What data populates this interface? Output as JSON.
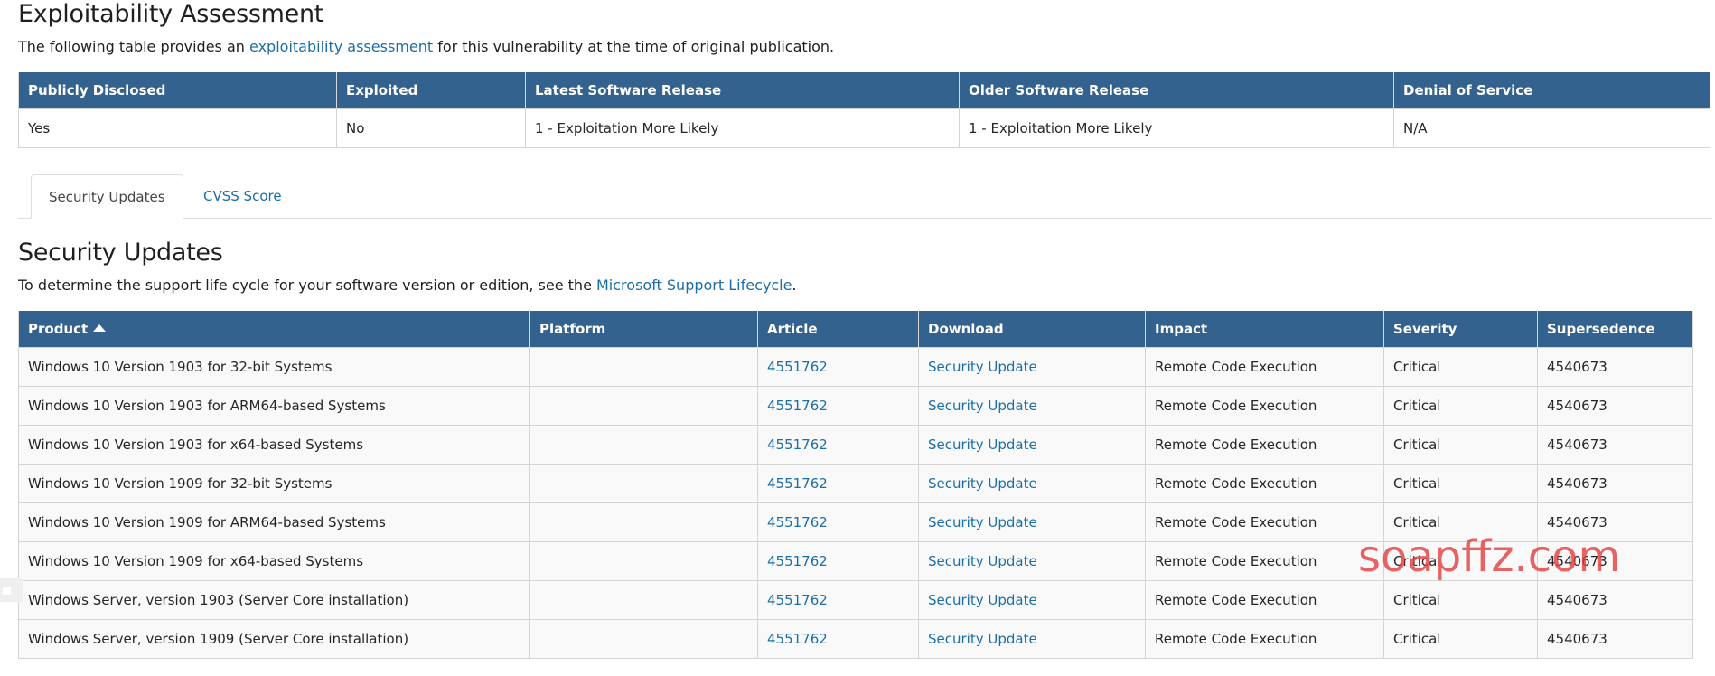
{
  "exploitability": {
    "title": "Exploitability Assessment",
    "lead_prefix": "The following table provides an ",
    "lead_link": "exploitability assessment",
    "lead_suffix": " for this vulnerability at the time of original publication.",
    "columns": [
      "Publicly Disclosed",
      "Exploited",
      "Latest Software Release",
      "Older Software Release",
      "Denial of Service"
    ],
    "row": {
      "publicly_disclosed": "Yes",
      "exploited": "No",
      "latest_release": "1 - Exploitation More Likely",
      "older_release": "1 - Exploitation More Likely",
      "denial_of_service": "N/A"
    }
  },
  "tabs": [
    {
      "label": "Security Updates",
      "active": true
    },
    {
      "label": "CVSS Score",
      "active": false
    }
  ],
  "security_updates": {
    "title": "Security Updates",
    "lead_prefix": "To determine the support life cycle for your software version or edition, see the ",
    "lead_link": "Microsoft Support Lifecycle",
    "lead_suffix": ".",
    "columns": [
      "Product",
      "Platform",
      "Article",
      "Download",
      "Impact",
      "Severity",
      "Supersedence"
    ],
    "rows": [
      {
        "product": "Windows 10 Version 1903 for 32-bit Systems",
        "platform": "",
        "article": "4551762",
        "download": "Security Update",
        "impact": "Remote Code Execution",
        "severity": "Critical",
        "supersedence": "4540673"
      },
      {
        "product": "Windows 10 Version 1903 for ARM64-based Systems",
        "platform": "",
        "article": "4551762",
        "download": "Security Update",
        "impact": "Remote Code Execution",
        "severity": "Critical",
        "supersedence": "4540673"
      },
      {
        "product": "Windows 10 Version 1903 for x64-based Systems",
        "platform": "",
        "article": "4551762",
        "download": "Security Update",
        "impact": "Remote Code Execution",
        "severity": "Critical",
        "supersedence": "4540673"
      },
      {
        "product": "Windows 10 Version 1909 for 32-bit Systems",
        "platform": "",
        "article": "4551762",
        "download": "Security Update",
        "impact": "Remote Code Execution",
        "severity": "Critical",
        "supersedence": "4540673"
      },
      {
        "product": "Windows 10 Version 1909 for ARM64-based Systems",
        "platform": "",
        "article": "4551762",
        "download": "Security Update",
        "impact": "Remote Code Execution",
        "severity": "Critical",
        "supersedence": "4540673"
      },
      {
        "product": "Windows 10 Version 1909 for x64-based Systems",
        "platform": "",
        "article": "4551762",
        "download": "Security Update",
        "impact": "Remote Code Execution",
        "severity": "Critical",
        "supersedence": "4540673"
      },
      {
        "product": "Windows Server, version 1903 (Server Core installation)",
        "platform": "",
        "article": "4551762",
        "download": "Security Update",
        "impact": "Remote Code Execution",
        "severity": "Critical",
        "supersedence": "4540673"
      },
      {
        "product": "Windows Server, version 1909 (Server Core installation)",
        "platform": "",
        "article": "4551762",
        "download": "Security Update",
        "impact": "Remote Code Execution",
        "severity": "Critical",
        "supersedence": "4540673"
      }
    ]
  },
  "watermark": "soapffz.com",
  "colors": {
    "header_bg": "#34628f",
    "link": "#1b6ea8",
    "watermark": "#e23c3c"
  }
}
